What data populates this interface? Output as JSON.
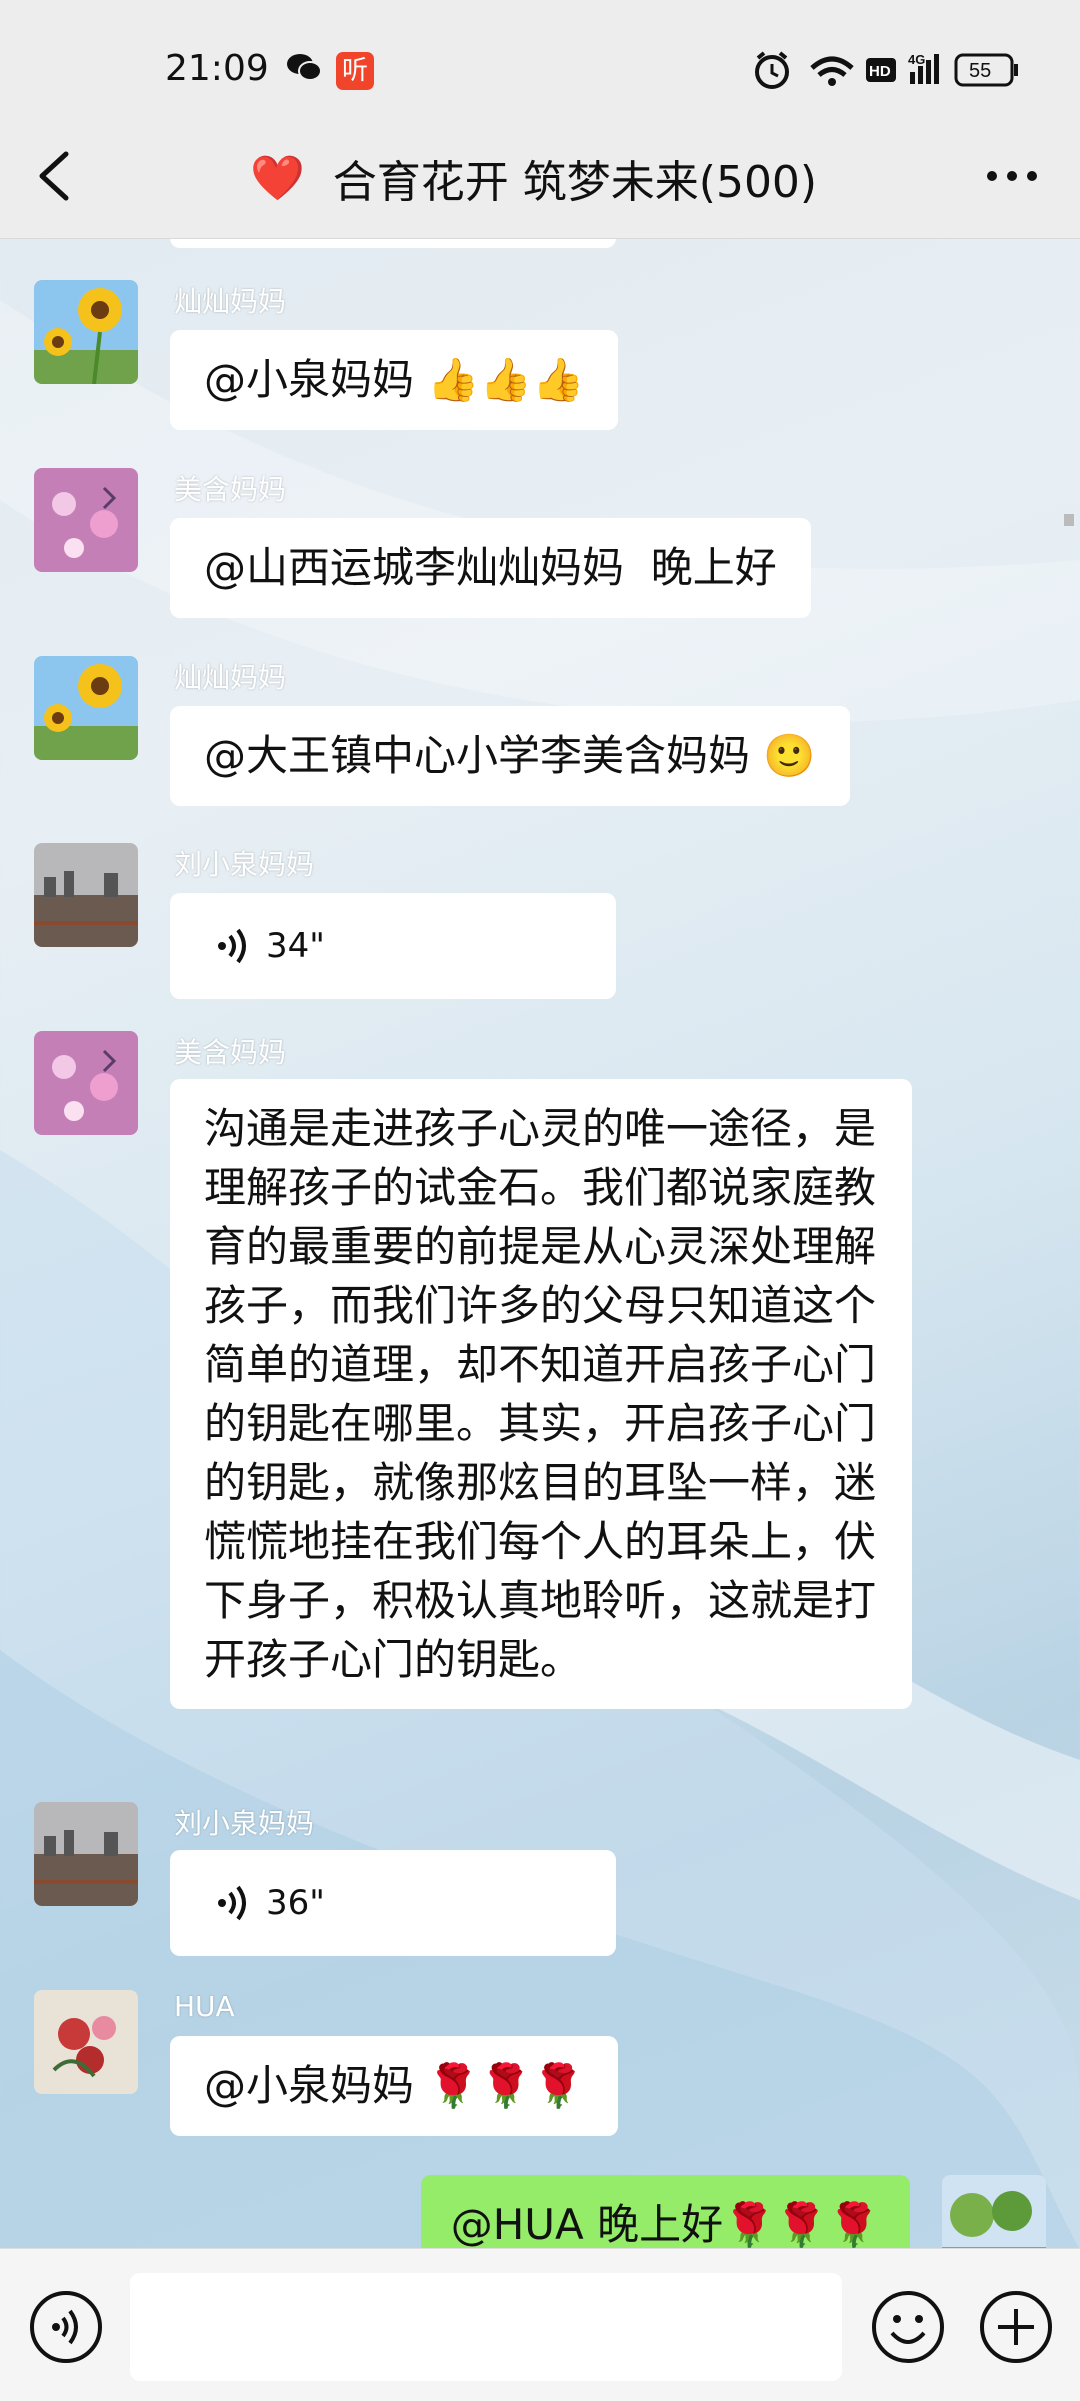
{
  "status_bar": {
    "time": "21:09",
    "ting_label": "听",
    "network": "4G",
    "hd": "HD",
    "battery": "55"
  },
  "header": {
    "title_heart": "❤️",
    "title": "合育花开 筑梦未来(500)"
  },
  "messages": [
    {
      "sender": "灿灿妈妈",
      "avatar": "sunflower",
      "text": "@小泉妈妈 👍👍👍"
    },
    {
      "sender": "美含妈妈",
      "avatar": "cosmos",
      "text": "@山西运城李灿灿妈妈  晚上好"
    },
    {
      "sender": "灿灿妈妈",
      "avatar": "sunflower",
      "text": "@大王镇中心小学李美含妈妈 🙂"
    },
    {
      "sender": "刘小泉妈妈",
      "avatar": "lake",
      "voice_duration": "34\""
    },
    {
      "sender": "美含妈妈",
      "avatar": "cosmos",
      "text": "沟通是走进孩子心灵的唯一途径，是理解孩子的试金石。我们都说家庭教育的最重要的前提是从心灵深处理解孩子，而我们许多的父母只知道这个简单的道理，却不知道开启孩子心门的钥匙在哪里。其实，开启孩子心门的钥匙，就像那炫目的耳坠一样，迷慌慌地挂在我们每个人的耳朵上，伏下身子，积极认真地聆听，这就是打开孩子心门的钥匙。"
    },
    {
      "sender": "刘小泉妈妈",
      "avatar": "lake",
      "voice_duration": "36\""
    },
    {
      "sender": "HUA",
      "avatar": "peony",
      "text": "@小泉妈妈 🌹🌹🌹"
    },
    {
      "sender": "me",
      "avatar": "trees",
      "text": "@HUA 晚上好🌹🌹🌹"
    }
  ],
  "colors": {
    "self_bubble": "#95ec69",
    "bubble": "#ffffff",
    "bar": "#ededed"
  },
  "icons": {
    "voice_toggle": "voice-icon",
    "emoji": "emoji-icon",
    "plus": "plus-icon",
    "back": "back-arrow-icon",
    "more": "more-icon"
  }
}
